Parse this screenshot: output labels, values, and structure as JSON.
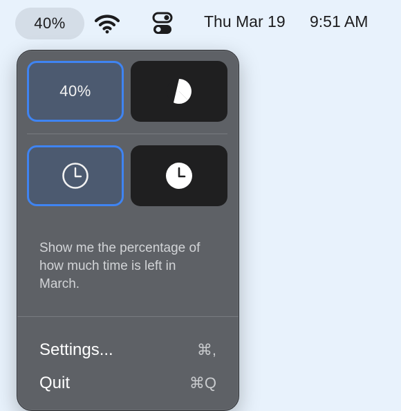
{
  "menubar": {
    "percent_item": "40%",
    "wifi_icon": "wifi-icon",
    "control_center_icon": "control-center-icon",
    "date": "Thu Mar 19",
    "time": "9:51 AM"
  },
  "popover": {
    "display_options": {
      "percent_label": "40%",
      "pie_icon": "pie-chart-icon"
    },
    "style_options": {
      "outline_clock_icon": "clock-outline-icon",
      "filled_clock_icon": "clock-filled-icon"
    },
    "description": "Show me the percentage of how much time is left in March.",
    "menu": [
      {
        "label": "Settings...",
        "shortcut": "⌘,"
      },
      {
        "label": "Quit",
        "shortcut": "⌘Q"
      }
    ]
  },
  "colors": {
    "accent": "#3f84f2",
    "panel": "#5e6166",
    "desktop": "#e8f2fc"
  }
}
